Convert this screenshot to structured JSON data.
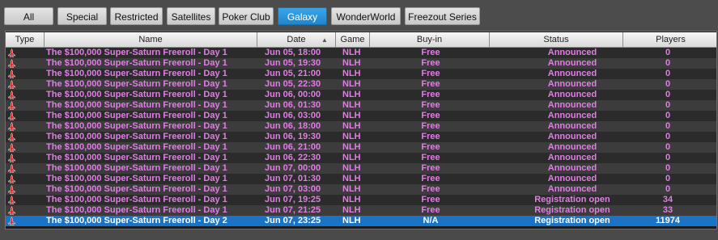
{
  "tabs": [
    "All",
    "Special",
    "Restricted",
    "Satellites",
    "Poker Club",
    "Galaxy",
    "WonderWorld",
    "Freezout Series"
  ],
  "active_tab": "Galaxy",
  "columns": [
    "Type",
    "Name",
    "Date",
    "Game",
    "Buy-in",
    "Status",
    "Players"
  ],
  "sort_column": "Date",
  "colors": {
    "row_text": "#e07ee4",
    "selected_bg": "#1a73c4",
    "tab_active": "#2a95dc",
    "type_icon": "#d8201c"
  },
  "rows": [
    {
      "type_icon": "rocket-icon",
      "name": "The $100,000 Super-Saturn Freeroll - Day 1",
      "date": "Jun 05, 18:00",
      "game": "NLH",
      "buyin": "Free",
      "status": "Announced",
      "players": "0"
    },
    {
      "type_icon": "rocket-icon",
      "name": "The $100,000 Super-Saturn Freeroll - Day 1",
      "date": "Jun 05, 19:30",
      "game": "NLH",
      "buyin": "Free",
      "status": "Announced",
      "players": "0"
    },
    {
      "type_icon": "rocket-icon",
      "name": "The $100,000 Super-Saturn Freeroll - Day 1",
      "date": "Jun 05, 21:00",
      "game": "NLH",
      "buyin": "Free",
      "status": "Announced",
      "players": "0"
    },
    {
      "type_icon": "rocket-icon",
      "name": "The $100,000 Super-Saturn Freeroll - Day 1",
      "date": "Jun 05, 22:30",
      "game": "NLH",
      "buyin": "Free",
      "status": "Announced",
      "players": "0"
    },
    {
      "type_icon": "rocket-icon",
      "name": "The $100,000 Super-Saturn Freeroll - Day 1",
      "date": "Jun 06, 00:00",
      "game": "NLH",
      "buyin": "Free",
      "status": "Announced",
      "players": "0"
    },
    {
      "type_icon": "rocket-icon",
      "name": "The $100,000 Super-Saturn Freeroll - Day 1",
      "date": "Jun 06, 01:30",
      "game": "NLH",
      "buyin": "Free",
      "status": "Announced",
      "players": "0"
    },
    {
      "type_icon": "rocket-icon",
      "name": "The $100,000 Super-Saturn Freeroll - Day 1",
      "date": "Jun 06, 03:00",
      "game": "NLH",
      "buyin": "Free",
      "status": "Announced",
      "players": "0"
    },
    {
      "type_icon": "rocket-icon",
      "name": "The $100,000 Super-Saturn Freeroll - Day 1",
      "date": "Jun 06, 18:00",
      "game": "NLH",
      "buyin": "Free",
      "status": "Announced",
      "players": "0"
    },
    {
      "type_icon": "rocket-icon",
      "name": "The $100,000 Super-Saturn Freeroll - Day 1",
      "date": "Jun 06, 19:30",
      "game": "NLH",
      "buyin": "Free",
      "status": "Announced",
      "players": "0"
    },
    {
      "type_icon": "rocket-icon",
      "name": "The $100,000 Super-Saturn Freeroll - Day 1",
      "date": "Jun 06, 21:00",
      "game": "NLH",
      "buyin": "Free",
      "status": "Announced",
      "players": "0"
    },
    {
      "type_icon": "rocket-icon",
      "name": "The $100,000 Super-Saturn Freeroll - Day 1",
      "date": "Jun 06, 22:30",
      "game": "NLH",
      "buyin": "Free",
      "status": "Announced",
      "players": "0"
    },
    {
      "type_icon": "rocket-icon",
      "name": "The $100,000 Super-Saturn Freeroll - Day 1",
      "date": "Jun 07, 00:00",
      "game": "NLH",
      "buyin": "Free",
      "status": "Announced",
      "players": "0"
    },
    {
      "type_icon": "rocket-icon",
      "name": "The $100,000 Super-Saturn Freeroll - Day 1",
      "date": "Jun 07, 01:30",
      "game": "NLH",
      "buyin": "Free",
      "status": "Announced",
      "players": "0"
    },
    {
      "type_icon": "rocket-icon",
      "name": "The $100,000 Super-Saturn Freeroll - Day 1",
      "date": "Jun 07, 03:00",
      "game": "NLH",
      "buyin": "Free",
      "status": "Announced",
      "players": "0"
    },
    {
      "type_icon": "rocket-icon",
      "name": "The $100,000 Super-Saturn Freeroll - Day 1",
      "date": "Jun 07, 19:25",
      "game": "NLH",
      "buyin": "Free",
      "status": "Registration open",
      "players": "34"
    },
    {
      "type_icon": "rocket-icon",
      "name": "The $100,000 Super-Saturn Freeroll - Day 1",
      "date": "Jun 07, 21:25",
      "game": "NLH",
      "buyin": "Free",
      "status": "Registration open",
      "players": "33"
    },
    {
      "type_icon": "rocket-icon",
      "name": "The $100,000 Super-Saturn Freeroll - Day 2",
      "date": "Jun 07, 23:25",
      "game": "NLH",
      "buyin": "N/A",
      "status": "Registration open",
      "players": "11974",
      "selected": true
    }
  ]
}
